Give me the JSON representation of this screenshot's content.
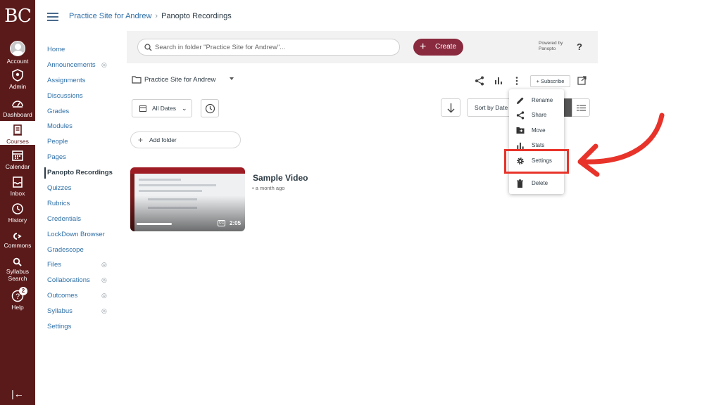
{
  "global_nav": {
    "logo": "BC",
    "items": [
      {
        "label": "Account",
        "icon": "account-avatar-icon"
      },
      {
        "label": "Admin",
        "icon": "shield-icon"
      },
      {
        "label": "Dashboard",
        "icon": "dashboard-gauge-icon"
      },
      {
        "label": "Courses",
        "icon": "courses-book-icon",
        "active": true
      },
      {
        "label": "Calendar",
        "icon": "calendar-icon"
      },
      {
        "label": "Inbox",
        "icon": "inbox-icon"
      },
      {
        "label": "History",
        "icon": "history-clock-icon"
      },
      {
        "label": "Commons",
        "icon": "commons-icon"
      },
      {
        "label": "Syllabus",
        "label2": "Search",
        "icon": "syllabus-search-icon"
      },
      {
        "label": "Help",
        "icon": "help-icon",
        "badge": "2"
      }
    ],
    "collapse_glyph": "|←"
  },
  "breadcrumb": {
    "course": "Practice Site for Andrew",
    "separator": "›",
    "current": "Panopto Recordings"
  },
  "course_nav": {
    "items": [
      {
        "label": "Home"
      },
      {
        "label": "Announcements",
        "hidden": true
      },
      {
        "label": "Assignments"
      },
      {
        "label": "Discussions"
      },
      {
        "label": "Grades"
      },
      {
        "label": "Modules"
      },
      {
        "label": "People"
      },
      {
        "label": "Pages"
      },
      {
        "label": "Panopto Recordings",
        "active": true
      },
      {
        "label": "Quizzes"
      },
      {
        "label": "Rubrics"
      },
      {
        "label": "Credentials"
      },
      {
        "label": "LockDown Browser"
      },
      {
        "label": "Gradescope"
      },
      {
        "label": "Files",
        "hidden": true
      },
      {
        "label": "Collaborations",
        "hidden": true
      },
      {
        "label": "Outcomes",
        "hidden": true
      },
      {
        "label": "Syllabus",
        "hidden": true
      },
      {
        "label": "Settings"
      }
    ]
  },
  "panopto": {
    "search_placeholder": "Search in folder \"Practice Site for Andrew\"...",
    "create_label": "Create",
    "powered_by": "Powered by",
    "powered_brand": "Panopto",
    "help_glyph": "?",
    "folder_name": "Practice Site for Andrew",
    "subscribe_label": "+ Subscribe",
    "dates_label": "All Dates",
    "sort_label": "Sort by Date",
    "add_folder_label": "Add folder",
    "video": {
      "title": "Sample Video",
      "date": "• a month ago",
      "duration": "2:05",
      "cc": "CC"
    },
    "menu": [
      {
        "label": "Rename",
        "icon": "pencil-icon"
      },
      {
        "label": "Share",
        "icon": "share-icon"
      },
      {
        "label": "Move",
        "icon": "folder-move-icon"
      },
      {
        "label": "Stats",
        "icon": "stats-bar-icon"
      },
      {
        "label": "Settings",
        "icon": "gear-icon",
        "highlighted": true
      },
      {
        "label": "Delete",
        "icon": "trash-icon"
      }
    ]
  },
  "colors": {
    "nav_bg": "#5b1a1a",
    "create_bg": "#8a2a3f",
    "link": "#2d6fa7",
    "annotation_red": "#e8332a"
  }
}
